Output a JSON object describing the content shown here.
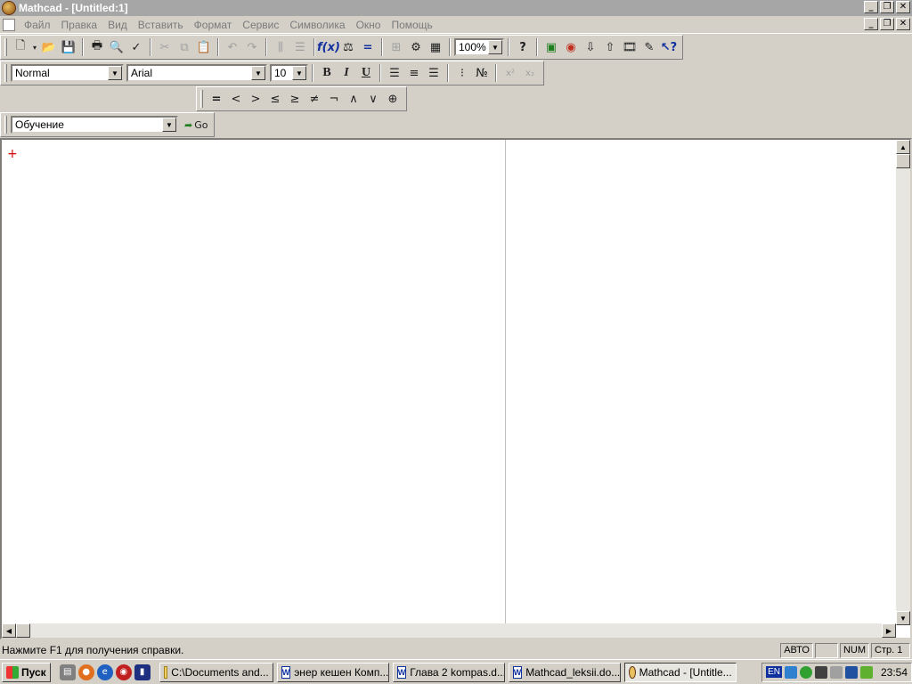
{
  "window": {
    "title": "Mathcad - [Untitled:1]"
  },
  "menu": [
    "Файл",
    "Правка",
    "Вид",
    "Вставить",
    "Формат",
    "Сервис",
    "Символика",
    "Окно",
    "Помощь"
  ],
  "toolbar": {
    "zoom": "100%"
  },
  "format": {
    "style": "Normal",
    "font": "Arial",
    "size": "10",
    "bold": "B",
    "italic": "I",
    "underline": "U"
  },
  "math_ops": [
    "=",
    "<",
    ">",
    "≤",
    "≥",
    "≠",
    "¬",
    "∧",
    "∨",
    "⊕"
  ],
  "resources": {
    "selected": "Обучение",
    "go_label": "Go"
  },
  "status": {
    "help": "Нажмите F1 для получения справки.",
    "mode": "АВТО",
    "num": "NUM",
    "page": "Стр. 1"
  },
  "taskbar": {
    "start": "Пуск",
    "tasks": [
      {
        "label": "C:\\Documents and...",
        "icon": "folder-icon"
      },
      {
        "label": "энер кешен Комп...",
        "icon": "word-icon"
      },
      {
        "label": "Глава 2 kompas.d...",
        "icon": "word-icon"
      },
      {
        "label": "Mathcad_leksii.do...",
        "icon": "word-icon"
      },
      {
        "label": "Mathcad - [Untitle...",
        "icon": "mathcad-icon"
      }
    ],
    "lang": "EN",
    "clock": "23:54"
  }
}
